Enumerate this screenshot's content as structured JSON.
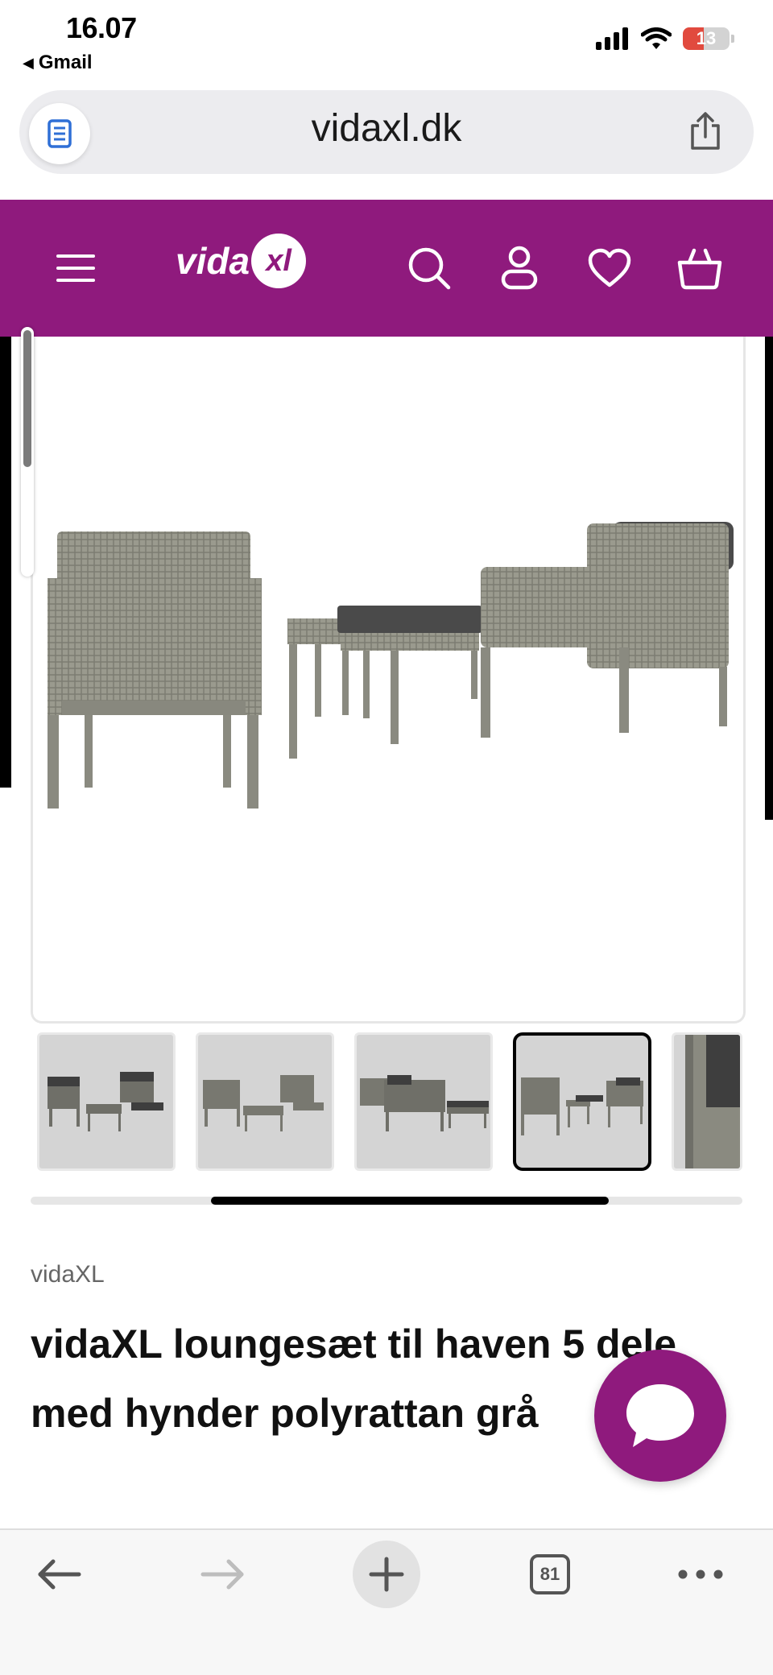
{
  "status_bar": {
    "time": "16.07",
    "back_app": "Gmail",
    "battery": "13"
  },
  "browser": {
    "url": "vidaxl.dk",
    "tab_count": "81"
  },
  "site": {
    "logo_text": "vida",
    "logo_mark": "xl",
    "brand_color": "#8f1a7d"
  },
  "product": {
    "brand": "vidaXL",
    "title": "vidaXL loungesæt til haven 5 dele med hynder polyrattan grå",
    "thumbnail_count": 5,
    "active_thumbnail": 4
  }
}
